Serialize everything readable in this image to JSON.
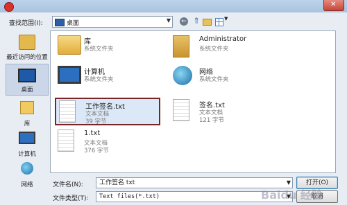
{
  "toolbar": {
    "look_in_label": "查找范围(I):",
    "location": "桌面"
  },
  "places": [
    {
      "label": "最近访问的位置",
      "icon": "recent-places-icon"
    },
    {
      "label": "桌面",
      "icon": "desktop-icon"
    },
    {
      "label": "库",
      "icon": "library-icon"
    },
    {
      "label": "计算机",
      "icon": "computer-icon"
    },
    {
      "label": "网络",
      "icon": "network-icon"
    }
  ],
  "files": [
    {
      "name": "库",
      "line1": "系统文件夹",
      "line2": ""
    },
    {
      "name": "Administrator",
      "line1": "系统文件夹",
      "line2": ""
    },
    {
      "name": "计算机",
      "line1": "系统文件夹",
      "line2": ""
    },
    {
      "name": "网络",
      "line1": "系统文件夹",
      "line2": ""
    },
    {
      "name": "工作签名.txt",
      "line1": "文本文档",
      "line2": "39 字节"
    },
    {
      "name": "签名.txt",
      "line1": "文本文档",
      "line2": "121 字节"
    },
    {
      "name": "1.txt",
      "line1": "文本文档",
      "line2": "376 字节"
    }
  ],
  "footer": {
    "filename_label": "文件名(N):",
    "filename_value": "工作签名 txt",
    "filetype_label": "文件类型(T):",
    "filetype_value": "Text files(*.txt)",
    "open_label": "打开(O)",
    "cancel_label": "取消"
  },
  "watermark": "Baidu 经验"
}
